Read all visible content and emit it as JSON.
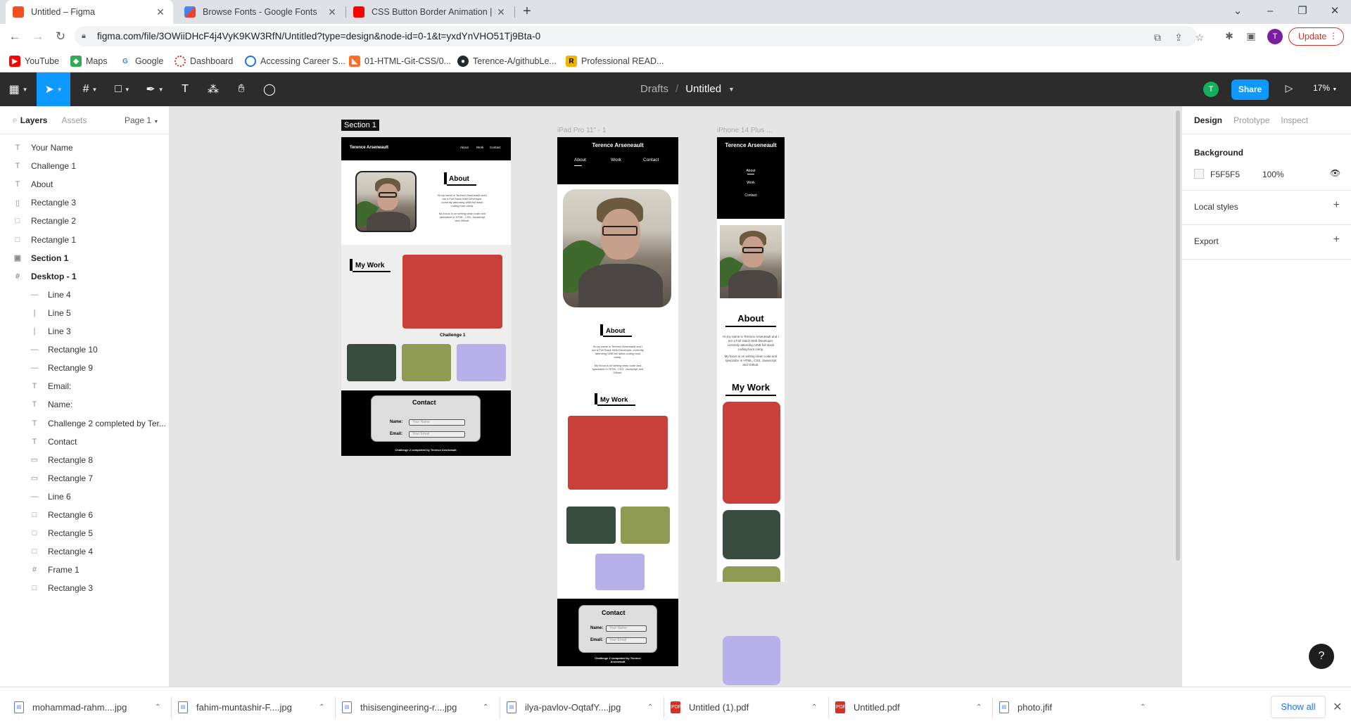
{
  "browser": {
    "tabs": [
      {
        "title": "Untitled – Figma",
        "favicon_color": "#f24e1e"
      },
      {
        "title": "Browse Fonts - Google Fonts",
        "favicon_color": "#4285f4"
      },
      {
        "title": "CSS Button Border Animation | H",
        "favicon_color": "#ff0000"
      }
    ],
    "url": "figma.com/file/3OWiiDHcF4j4VyK9KW3RfN/Untitled?type=design&node-id=0-1&t=yxdYnVHO51Tj9Bta-0",
    "profile_initial": "T",
    "update_label": "Update",
    "bookmarks": [
      {
        "label": "YouTube",
        "color": "#ff0000"
      },
      {
        "label": "Maps",
        "color": "#34a853"
      },
      {
        "label": "Google",
        "color": "#4285f4"
      },
      {
        "label": "Dashboard",
        "color": "#d93025"
      },
      {
        "label": "Accessing Career S...",
        "color": "#1a73e8"
      },
      {
        "label": "01-HTML-Git-CSS/0...",
        "color": "#fc6d26"
      },
      {
        "label": "Terence-A/githubLe...",
        "color": "#24292e"
      },
      {
        "label": "Professional READ...",
        "color": "#f0b400"
      }
    ]
  },
  "figma": {
    "breadcrumb_drafts": "Drafts",
    "breadcrumb_sep": "/",
    "file_title": "Untitled",
    "collab_initial": "T",
    "share_label": "Share",
    "zoom": "17%",
    "left_panel": {
      "tab_layers": "Layers",
      "tab_assets": "Assets",
      "page": "Page 1",
      "layers": [
        {
          "icon": "T",
          "name": "Your Name",
          "indent": 0
        },
        {
          "icon": "T",
          "name": "Challenge 1",
          "indent": 0
        },
        {
          "icon": "T",
          "name": "About",
          "indent": 0
        },
        {
          "icon": "▯",
          "name": "Rectangle 3",
          "indent": 0
        },
        {
          "icon": "□",
          "name": "Rectangle 2",
          "indent": 0
        },
        {
          "icon": "□",
          "name": "Rectangle 1",
          "indent": 0
        },
        {
          "icon": "▣",
          "name": "Section 1",
          "indent": 0,
          "bold": true
        },
        {
          "icon": "#",
          "name": "Desktop - 1",
          "indent": 0,
          "bold": true
        },
        {
          "icon": "—",
          "name": "Line 4",
          "indent": 1
        },
        {
          "icon": "|",
          "name": "Line 5",
          "indent": 1
        },
        {
          "icon": "|",
          "name": "Line 3",
          "indent": 1
        },
        {
          "icon": "—",
          "name": "Rectangle 10",
          "indent": 1
        },
        {
          "icon": "—",
          "name": "Rectangle 9",
          "indent": 1
        },
        {
          "icon": "T",
          "name": "Email:",
          "indent": 1
        },
        {
          "icon": "T",
          "name": "Name:",
          "indent": 1
        },
        {
          "icon": "T",
          "name": "Challenge 2 completed by Ter...",
          "indent": 1
        },
        {
          "icon": "T",
          "name": "Contact",
          "indent": 1
        },
        {
          "icon": "▭",
          "name": "Rectangle 8",
          "indent": 1
        },
        {
          "icon": "▭",
          "name": "Rectangle 7",
          "indent": 1
        },
        {
          "icon": "—",
          "name": "Line 6",
          "indent": 1
        },
        {
          "icon": "□",
          "name": "Rectangle 6",
          "indent": 1
        },
        {
          "icon": "□",
          "name": "Rectangle 5",
          "indent": 1
        },
        {
          "icon": "□",
          "name": "Rectangle 4",
          "indent": 1
        },
        {
          "icon": "#",
          "name": "Frame 1",
          "indent": 1
        },
        {
          "icon": "□",
          "name": "Rectangle 3",
          "indent": 1
        }
      ]
    },
    "right_panel": {
      "tab_design": "Design",
      "tab_prototype": "Prototype",
      "tab_inspect": "Inspect",
      "background_label": "Background",
      "background_hex": "F5F5F5",
      "background_opacity": "100%",
      "local_styles_label": "Local styles",
      "export_label": "Export"
    },
    "canvas": {
      "section_label": "Section 1",
      "ipad_label": "iPad Pro 11\" - 1",
      "iphone_label": "iPhone 14 Plus ...",
      "site": {
        "name": "Terence Arseneault",
        "nav": [
          "About",
          "Work",
          "Contact"
        ],
        "about_heading": "About",
        "about_text_1": "Hi,my name is Terence Arseneault and I am a Full Stack Web Developer, currently attending UNB full stack coding boot camp.",
        "about_text_2": "My focus is on writing clean code and specialize in HTML, CSS, Javascript and Github.",
        "work_heading": "My Work",
        "challenge_label": "Challenge 1",
        "contact_heading": "Contact",
        "name_label": "Name:",
        "email_label": "Email:",
        "name_placeholder": "Your Name",
        "email_placeholder": "Your Email",
        "footer": "Challenge 2 completed by Terence Arseneault"
      }
    }
  },
  "downloads": {
    "items": [
      {
        "name": "mohammad-rahm....jpg",
        "type": "img"
      },
      {
        "name": "fahim-muntashir-F....jpg",
        "type": "img"
      },
      {
        "name": "thisisengineering-r....jpg",
        "type": "img"
      },
      {
        "name": "ilya-pavlov-OqtafY....jpg",
        "type": "img"
      },
      {
        "name": "Untitled (1).pdf",
        "type": "pdf"
      },
      {
        "name": "Untitled.pdf",
        "type": "pdf"
      },
      {
        "name": "photo.jfif",
        "type": "img"
      }
    ],
    "show_all": "Show all"
  }
}
